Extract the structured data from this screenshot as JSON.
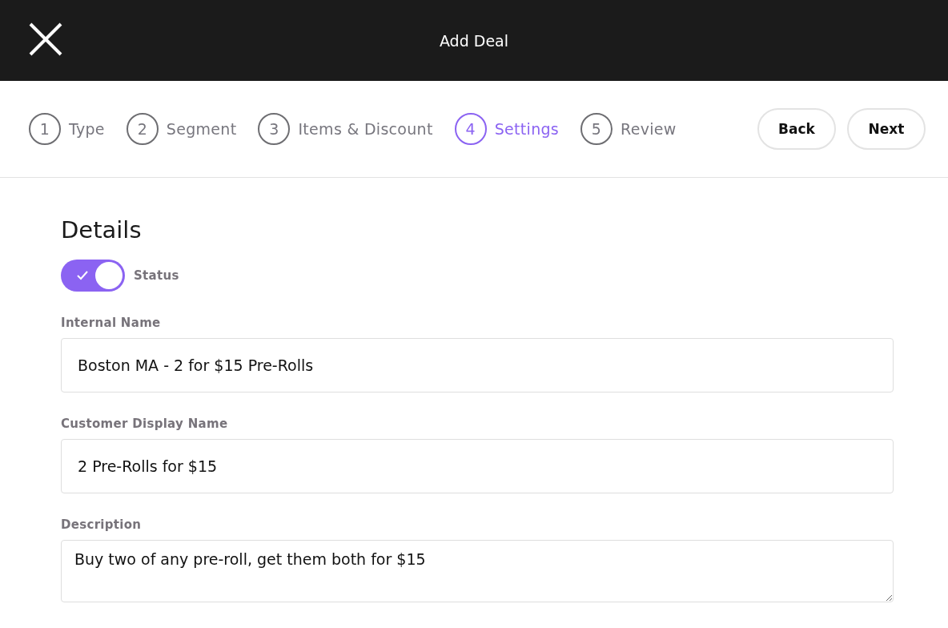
{
  "header": {
    "title": "Add Deal"
  },
  "steps": [
    {
      "number": "1",
      "label": "Type",
      "selected": false
    },
    {
      "number": "2",
      "label": "Segment",
      "selected": false
    },
    {
      "number": "3",
      "label": "Items & Discount",
      "selected": false
    },
    {
      "number": "4",
      "label": "Settings",
      "selected": true
    },
    {
      "number": "5",
      "label": "Review",
      "selected": false
    }
  ],
  "buttons": [
    "Back",
    "Next"
  ],
  "section": {
    "title": "Details"
  },
  "status": {
    "label": "Status",
    "on": true
  },
  "fields": [
    {
      "kind": "input",
      "label": "Internal Name",
      "value": "Boston MA - 2 for $15 Pre-Rolls"
    },
    {
      "kind": "input",
      "label": "Customer Display Name",
      "value": "2 Pre-Rolls for $15"
    },
    {
      "kind": "textarea",
      "label": "Description",
      "value": "Buy two of any pre-roll, get them both for $15"
    }
  ]
}
